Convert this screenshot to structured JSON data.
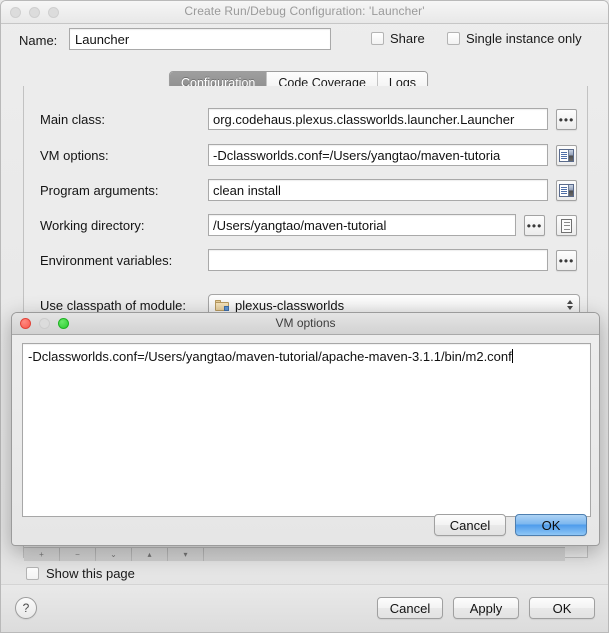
{
  "main_window": {
    "title": "Create Run/Debug Configuration: 'Launcher'",
    "traffic_lights": [
      "close-icon",
      "minimize-icon",
      "zoom-icon"
    ],
    "name_field": {
      "label": "Name:",
      "value": "Launcher"
    },
    "options": [
      {
        "label": "Share",
        "checked": false
      },
      {
        "label": "Single instance only",
        "checked": false
      }
    ],
    "tabs": [
      {
        "label": "Configuration",
        "active": true
      },
      {
        "label": "Code Coverage",
        "active": false
      },
      {
        "label": "Logs",
        "active": false
      }
    ],
    "fields": [
      {
        "label": "Main class:",
        "value": "org.codehaus.plexus.classworlds.launcher.Launcher",
        "buttons": [
          "ellipsis-icon"
        ]
      },
      {
        "label": "VM options:",
        "value": "-Dclassworlds.conf=/Users/yangtao/maven-tutoria",
        "buttons": [
          "expand-editor-icon"
        ]
      },
      {
        "label": "Program arguments:",
        "value": "clean install",
        "buttons": [
          "expand-editor-icon"
        ]
      },
      {
        "label": "Working directory:",
        "value": "/Users/yangtao/maven-tutorial",
        "buttons": [
          "ellipsis-icon",
          "macro-document-icon"
        ]
      },
      {
        "label": "Environment variables:",
        "value": "",
        "buttons": [
          "ellipsis-icon"
        ]
      }
    ],
    "module_row": {
      "label": "Use classpath of module:",
      "value": "plexus-classworlds",
      "icon": "folder-module-icon"
    },
    "show_this_page": {
      "label": "Show this page",
      "checked": false
    },
    "help_button": "?",
    "buttons": [
      {
        "label": "Cancel",
        "default": false
      },
      {
        "label": "Apply",
        "default": false
      },
      {
        "label": "OK",
        "default": false
      }
    ]
  },
  "modal": {
    "title": "VM options",
    "traffic_lights": [
      "close-icon",
      "minimize-icon",
      "zoom-icon"
    ],
    "textarea_value": "-Dclassworlds.conf=/Users/yangtao/maven-tutorial/apache-maven-3.1.1/bin/m2.conf",
    "buttons": [
      {
        "label": "Cancel",
        "default": false
      },
      {
        "label": "OK",
        "default": true
      }
    ]
  },
  "colors": {
    "default_button_accent": "#4e9ceb",
    "active_tab_bg": "#8c8c8c",
    "window_bg": "#e9e9e9",
    "panel_bg": "#ececec",
    "title_text": "#9a9a9a"
  }
}
